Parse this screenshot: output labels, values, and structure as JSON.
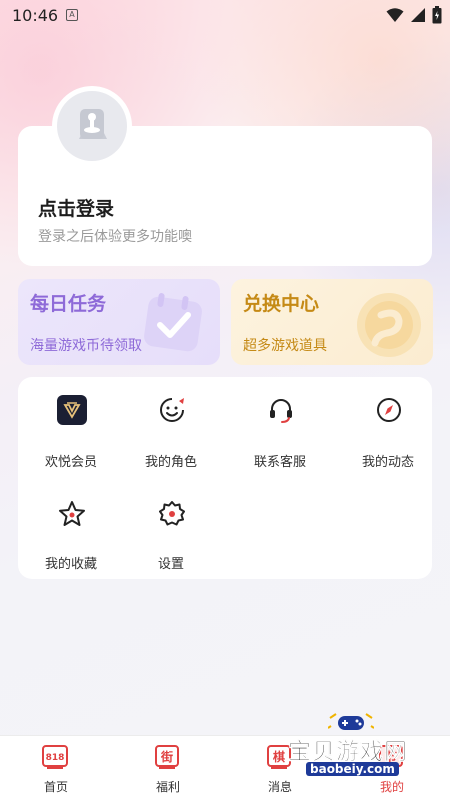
{
  "status_bar": {
    "time": "10:46",
    "indicator": "A",
    "icons": [
      "wifi-icon",
      "signal-icon",
      "battery-icon"
    ]
  },
  "profile": {
    "title": "点击登录",
    "subtitle": "登录之后体验更多功能噢"
  },
  "promos": [
    {
      "title": "每日任务",
      "subtitle": "海量游戏币待领取",
      "icon": "calendar-check-icon",
      "color": "#8e6ad8"
    },
    {
      "title": "兑换中心",
      "subtitle": "超多游戏道具",
      "icon": "coin-icon",
      "color": "#c58a16"
    }
  ],
  "menu": {
    "items": [
      {
        "label": "欢悦会员",
        "icon": "vip-badge-icon"
      },
      {
        "label": "我的角色",
        "icon": "smiley-face-icon"
      },
      {
        "label": "联系客服",
        "icon": "headset-icon"
      },
      {
        "label": "我的动态",
        "icon": "compass-icon"
      },
      {
        "label": "我的收藏",
        "icon": "star-icon"
      },
      {
        "label": "设置",
        "icon": "settings-gear-icon"
      }
    ]
  },
  "bottom_nav": {
    "items": [
      {
        "label": "首页",
        "badge": "818"
      },
      {
        "label": "福利",
        "badge": "街"
      },
      {
        "label": "消息",
        "badge": "棋"
      },
      {
        "label": "我的",
        "badge": "节"
      }
    ],
    "active_color": "#e04040"
  },
  "watermark": {
    "text": "宝贝游戏网",
    "url": "baobeiy.com"
  },
  "colors": {
    "accent_purple": "#8e6ad8",
    "accent_gold": "#c58a16",
    "card_bg": "#ffffff"
  }
}
